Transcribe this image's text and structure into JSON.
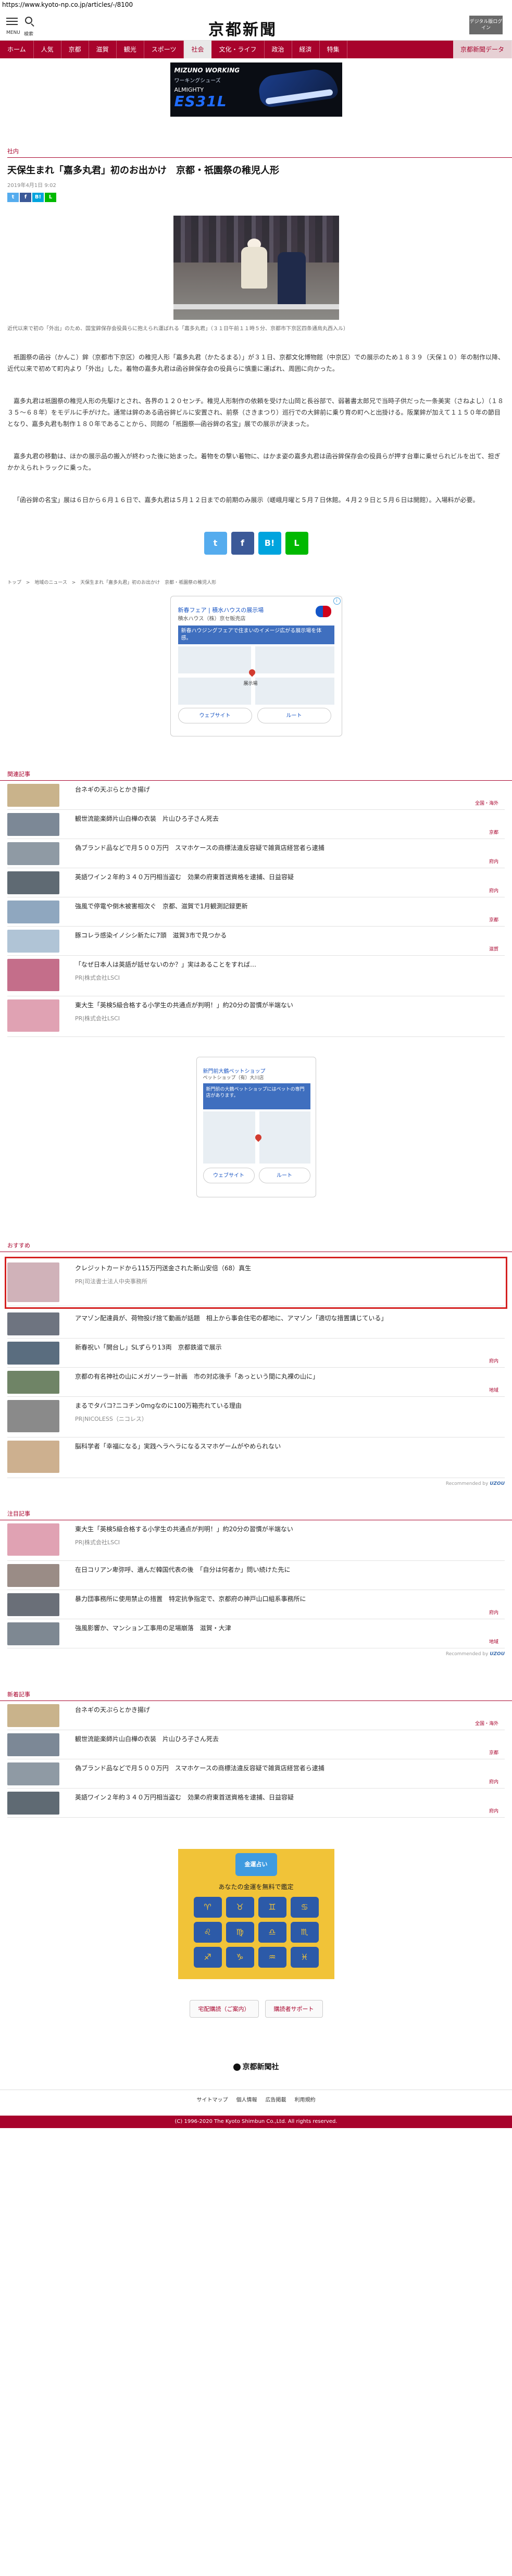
{
  "browser": {
    "url": "https://www.kyoto-np.co.jp/articles/-/8100"
  },
  "header": {
    "logo": "京都新聞",
    "menu_label": "MENU",
    "search_label": "検索",
    "digital_label": "デジタル版ログイン"
  },
  "nav": [
    {
      "label": "ホーム"
    },
    {
      "label": "人気"
    },
    {
      "label": "京都"
    },
    {
      "label": "滋賀"
    },
    {
      "label": "観光"
    },
    {
      "label": "スポーツ"
    },
    {
      "label": "社会"
    },
    {
      "label": "文化・ライフ"
    },
    {
      "label": "政治"
    },
    {
      "label": "経済"
    },
    {
      "label": "特集"
    },
    {
      "label": "京都新聞データ"
    }
  ],
  "nav_active_index": 6,
  "ad_top": {
    "brand": "MIZUNO WORKING",
    "sub": "ワーキングシューズ",
    "name": "ALMIGHTY",
    "model": "ES31L"
  },
  "article": {
    "section": "社内",
    "title": "天保生まれ「嘉多丸君」初のお出かけ　京都・祇園祭の稚児人形",
    "date": "2019年4月1日 9:02",
    "caption": "近代以来で初の「外出」のため、国宝鉾保存会役員らに抱えられ運ばれる「嘉多丸君」（３１日午前１１時５分、京都市下京区四条通烏丸西入ル）",
    "paragraphs": [
      "祇園祭の函谷（かんこ）鉾（京都市下京区）の稚児人形「嘉多丸君（かたるまる）」が３１日、京都文化博物館（中京区）での展示のため１８３９（天保１０）年の制作以降、近代以来で初めて町内より「外出」した。着物の嘉多丸君は函谷鉾保存会の役員らに慎重に運ばれ、周囲に向かった。",
      "嘉多丸君は祇園祭の稚児人形の先駆けとされ、各界の１２０センチ。稚児人形制作の依頼を受けた山岡と長谷部で、弱著書太郎兄で当時子供だった一条美実（さねよし）（１８３５～６８年）をモデルに手がけた。通常は鉾のある函谷鉾ビルに安置され、前祭（さきまつり）巡行での大鉾前に乗り育の町へと出掛ける。阪業鉾が加えて１１５０年の節目となり、嘉多丸君も制作１８０年であることから、同館の「祇園祭―函谷鉾の名宝」展での展示が決まった。",
      "嘉多丸君の移動は、ほかの展示品の搬入が終わった後に始まった。着物をの撃い着物に、はかま姿の嘉多丸君は函谷鉾保存会の役員らが押す台車に乗せられビルを出て、担ぎかかえられトラックに乗った。",
      "「函谷鉾の名宝」展は６日から６月１６日で、嘉多丸君は５月１２日までの前期のみ展示（嵯峨月曜と５月７日休館。４月２９日と５月６日は開館）。入場料が必要。"
    ]
  },
  "share": {
    "twitter": "t",
    "facebook": "f",
    "hatena": "B!",
    "line": "L"
  },
  "breadcrumb": [
    "トップ",
    ">",
    "地域のニュース",
    ">",
    "天保生まれ「嘉多丸君」初のお出かけ　京都・祇園祭の稚児人形"
  ],
  "map_ad_1": {
    "title": "新春フェア | 積水ハウスの展示場",
    "sub": "積水ハウス（株）京セ販売店",
    "image_text": "新春ハウジングフェアで住まいのイメージ広がる展示場を体感。",
    "pin_label": "展示場",
    "btn_left": "ウェブサイト",
    "btn_right": "ルート"
  },
  "related": {
    "heading": "関連記事",
    "items": [
      {
        "title": "台ネギの天ぷらとかき揚げ",
        "cat": "全国・海外",
        "color": "#c9b38b"
      },
      {
        "title": "観世流能楽師片山白樺の衣装　片山ひろ子さん死去",
        "cat": "京都",
        "color": "#7c8896"
      },
      {
        "title": "偽ブランド品などで月５００万円　スマホケースの商標法違反容疑で雑貨店経営者ら逮捕",
        "cat": "府内",
        "color": "#8f9aa4"
      },
      {
        "title": "英語ワイン２年約３４０万円相当盗む　効果の府東首送資格を逮捕、日益容疑",
        "cat": "府内",
        "color": "#5f6a73"
      },
      {
        "title": "強風で停電や倒木被害相次ぐ　京都、滋賀で1月観測記録更新",
        "cat": "京都",
        "color": "#8fa7bf"
      },
      {
        "title": "豚コレラ感染イノシシ新たに7頭　滋賀3市で見つかる",
        "cat": "滋賀",
        "color": "#b0c4d6"
      },
      {
        "title": "「なぜ日本人は英語が話せないのか？」実はあることをすれば…",
        "sponsor": "PR|株式会社LSCI",
        "color": "#c46e8a"
      },
      {
        "title": "東大生「英検5級合格する小学生の共通点が判明！」約20分の習慣が半端ない",
        "sponsor": "PR|株式会社LSCI",
        "color": "#e0a2b3"
      }
    ]
  },
  "map_ad_2": {
    "title": "新門前大鶴ペットショップ",
    "sub": "ペットショップ（有）大川店",
    "image_text": "新門前の大鶴ペットショップにはペットの専門店があります。",
    "btn_left": "ウェブサイト",
    "btn_right": "ルート"
  },
  "recommend": {
    "heading": "おすすめ",
    "items": [
      {
        "title": "クレジットカードから115万円送金された新山安倍（68）真生",
        "sponsor": "PR|司法書士法人中央事務所",
        "color": "#d0b2b9",
        "highlight": true
      },
      {
        "title": "アマゾン配達員が、荷物投げ捨て動画が話題　相上から事会住宅の都地に、アマゾン「適切な措置講じている」",
        "cat": "",
        "color": "#6e7480"
      },
      {
        "title": "新春祝い「開台し」SLずらり13両　京都鉄道で展示",
        "cat": "府内",
        "color": "#5a6d7f"
      },
      {
        "title": "京都の有名神社の山にメガソーラー計画　市の対応後手「あっという間に丸裸の山に」",
        "cat": "地域",
        "color": "#6f8466"
      },
      {
        "title": "まるでタバコ?ニコチン0mgなのに100万箱売れている理由",
        "sponsor": "PR|NICOLESS（ニコレス）",
        "color": "#8a8a8a"
      },
      {
        "title": "脳科学者「幸福になる」実践ヘラヘラになるスマホゲームがやめられない",
        "sponsor": "",
        "color": "#cdb08f"
      }
    ],
    "powered": "Recommended by",
    "powered_brand": "UZOU"
  },
  "popular": {
    "heading": "注目記事",
    "items": [
      {
        "title": "東大生「英検5級合格する小学生の共通点が判明！」約20分の習慣が半端ない",
        "sponsor": "PR|株式会社LSCI",
        "color": "#e0a2b3"
      },
      {
        "title": "在日コリアン卑弥呼、遺んだ韓国代表の後　「自分は何者か」問い続けた先に",
        "cat": "",
        "color": "#9a8c86"
      },
      {
        "title": "暴力団事務所に使用禁止の措置　特定抗争指定で、京都府の神戸山口組系事務所に",
        "cat": "府内",
        "color": "#6a6f78"
      },
      {
        "title": "強風影響か、マンション工事用の足場崩落　滋賀・大津",
        "cat": "地域",
        "color": "#7e8892"
      }
    ],
    "powered": "Recommended by",
    "powered_brand": "UZOU"
  },
  "latest": {
    "heading": "新着記事",
    "items": [
      {
        "title": "台ネギの天ぷらとかき揚げ",
        "cat": "全国・海外",
        "color": "#c9b38b"
      },
      {
        "title": "観世流能楽師片山白樺の衣装　片山ひろ子さん死去",
        "cat": "京都",
        "color": "#7c8896"
      },
      {
        "title": "偽ブランド品などで月５００万円　スマホケースの商標法違反容疑で雑貨店経営者ら逮捕",
        "cat": "府内",
        "color": "#8f9aa4"
      },
      {
        "title": "英語ワイン２年約３４０万円相当盗む　効果の府東首送資格を逮捕、日益容疑",
        "cat": "府内",
        "color": "#5f6a73"
      }
    ]
  },
  "bottom_ad": {
    "badge": "金運占い",
    "title": "あなたの金運を無料で鑑定",
    "signs": [
      "♈",
      "♉",
      "♊",
      "♋",
      "♌",
      "♍",
      "♎",
      "♏",
      "♐",
      "♑",
      "♒",
      "♓"
    ]
  },
  "tag_buttons": [
    "宅配購読（ご案内）",
    "購読者サポート"
  ],
  "footer": {
    "logo": "京都新聞社",
    "links": [
      "サイトマップ",
      "個人情報",
      "広告掲載",
      "利用規約"
    ],
    "copyright": "(C) 1996-2020 The Kyoto Shimbun Co.,Ltd. All rights reserved."
  },
  "colors": {
    "brand": "#a8032c",
    "twitter": "#55acee",
    "facebook": "#3b5998",
    "hatena": "#00a4de",
    "line": "#00b900"
  }
}
